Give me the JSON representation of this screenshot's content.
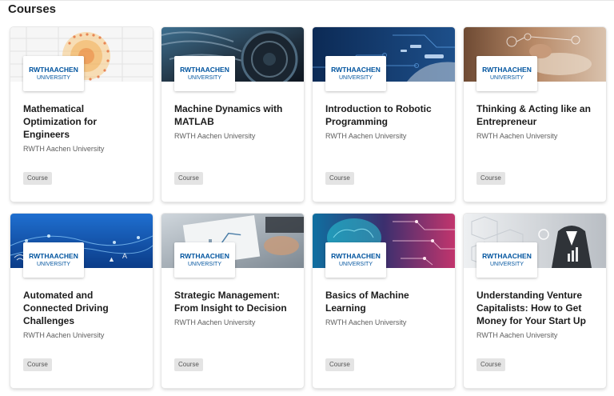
{
  "page": {
    "heading": "Courses"
  },
  "colors": {
    "rwth_blue": "#00549f"
  },
  "logo": {
    "line1": "RWTHAACHEN",
    "line2": "UNIVERSITY"
  },
  "courses": [
    {
      "title_lines": [
        "Mathematical",
        "Optimization for",
        "Engineers"
      ],
      "org": "RWTH Aachen University",
      "badge": "Course"
    },
    {
      "title_lines": [
        "Machine Dynamics with",
        "MATLAB"
      ],
      "org": "RWTH Aachen University",
      "badge": "Course"
    },
    {
      "title_lines": [
        "Introduction to Robotic",
        "Programming"
      ],
      "org": "RWTH Aachen University",
      "badge": "Course"
    },
    {
      "title_lines": [
        "Thinking & Acting like an",
        "Entrepreneur"
      ],
      "org": "RWTH Aachen University",
      "badge": "Course"
    },
    {
      "title_lines": [
        "Automated and",
        "Connected Driving",
        "Challenges"
      ],
      "org": "RWTH Aachen University",
      "badge": "Course"
    },
    {
      "title_lines": [
        "Strategic Management:",
        "From Insight to Decision"
      ],
      "org": "RWTH Aachen University",
      "badge": "Course"
    },
    {
      "title_lines": [
        "Basics of Machine",
        "Learning"
      ],
      "org": "RWTH Aachen University",
      "badge": "Course"
    },
    {
      "title_lines": [
        "Understanding Venture",
        "Capitalists: How to Get",
        "Money for Your Start Up"
      ],
      "org": "RWTH Aachen University",
      "badge": "Course"
    }
  ]
}
